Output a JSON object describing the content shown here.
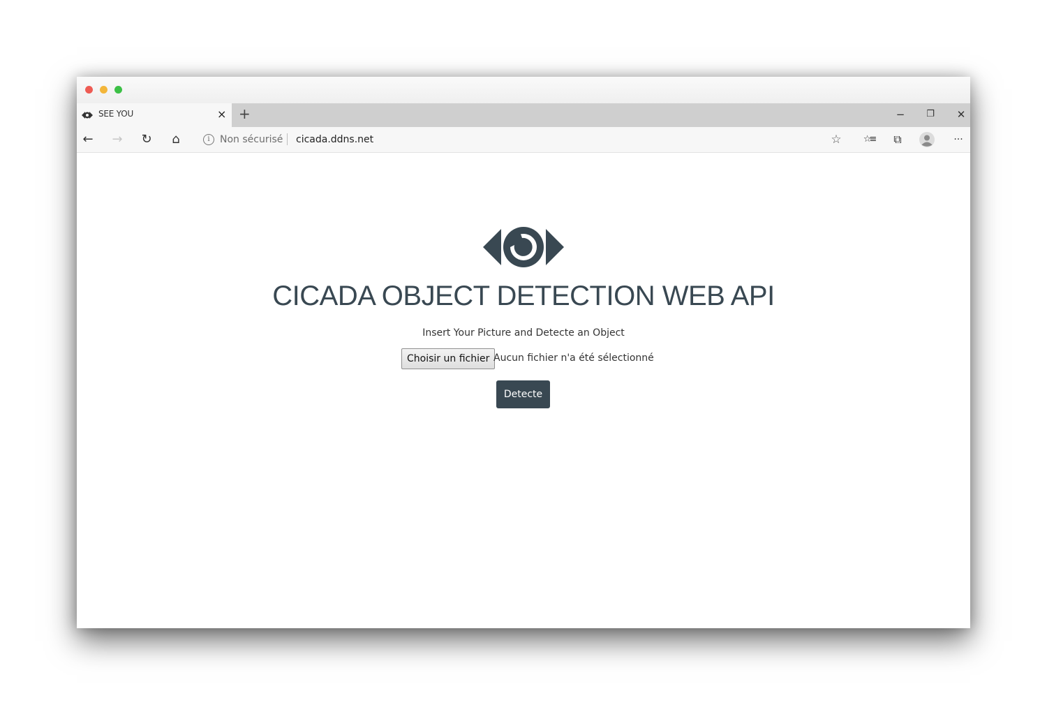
{
  "browser": {
    "tab": {
      "title": "SEE YOU",
      "close_label": "×",
      "favicon": "eye-icon"
    },
    "new_tab_label": "+",
    "window_controls": {
      "minimize": "−",
      "restore": "❐",
      "close": "✕"
    },
    "toolbar": {
      "back": "←",
      "forward": "→",
      "refresh": "↻",
      "home": "⌂",
      "favorite": "☆",
      "favorites_hub": "☆≡",
      "collections": "⧉",
      "menu": "···"
    },
    "address": {
      "info": "i",
      "security_label": "Non sécurisé",
      "url": "cicada.ddns.net"
    }
  },
  "page": {
    "logo": "eye-icon",
    "heading": "CICADA OBJECT DETECTION WEB API",
    "subtitle": "Insert Your Picture and Detecte an Object",
    "file_button_label": "Choisir un fichier",
    "file_status": "Aucun fichier n'a été sélectionné",
    "submit_label": "Detecte"
  },
  "colors": {
    "accent": "#394852",
    "mac_close": "#ee5b53",
    "mac_minimize": "#f3b63a",
    "mac_zoom": "#3cc046"
  }
}
